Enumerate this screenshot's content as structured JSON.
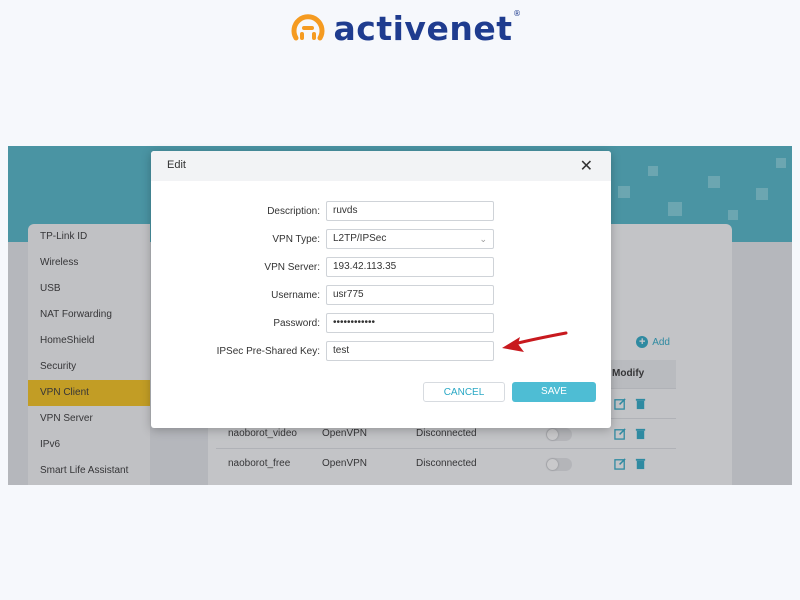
{
  "brand": {
    "name": "activenet",
    "reg_mark": "®",
    "orange": "#f59b21",
    "blue": "#1f3c8f"
  },
  "sidebar": {
    "items": [
      {
        "label": "TP-Link ID"
      },
      {
        "label": "Wireless"
      },
      {
        "label": "USB"
      },
      {
        "label": "NAT Forwarding"
      },
      {
        "label": "HomeShield"
      },
      {
        "label": "Security"
      },
      {
        "label": "VPN Client",
        "active": true
      },
      {
        "label": "VPN Server"
      },
      {
        "label": "IPv6"
      },
      {
        "label": "Smart Life Assistant"
      }
    ],
    "active_color": "#f6c21a"
  },
  "panel": {
    "add_label": "Add",
    "modify_header": "Modify",
    "rows": [
      {
        "name": "",
        "type": "",
        "status": ""
      },
      {
        "name": "naoborot_video",
        "type": "OpenVPN",
        "status": "Disconnected"
      },
      {
        "name": "naoborot_free",
        "type": "OpenVPN",
        "status": "Disconnected"
      }
    ]
  },
  "modal": {
    "title": "Edit",
    "fields": {
      "description": {
        "label": "Description:",
        "value": "ruvds"
      },
      "vpn_type": {
        "label": "VPN Type:",
        "value": "L2TP/IPSec"
      },
      "vpn_server": {
        "label": "VPN Server:",
        "value": "193.42.113.35"
      },
      "username": {
        "label": "Username:",
        "value": "usr775"
      },
      "password": {
        "label": "Password:",
        "value": "••••••••••••"
      },
      "psk": {
        "label": "IPSec Pre-Shared Key:",
        "value": "test"
      }
    },
    "cancel_label": "CANCEL",
    "save_label": "SAVE"
  },
  "colors": {
    "teal": "#4fb6c8",
    "accent": "#2aa8c5",
    "arrow": "#c8191e"
  },
  "icons": {
    "close": "close-icon",
    "chevron": "chevron-down-icon",
    "add": "plus-circle-icon",
    "edit": "edit-icon",
    "delete": "trash-icon",
    "arrow": "red-arrow-icon"
  }
}
